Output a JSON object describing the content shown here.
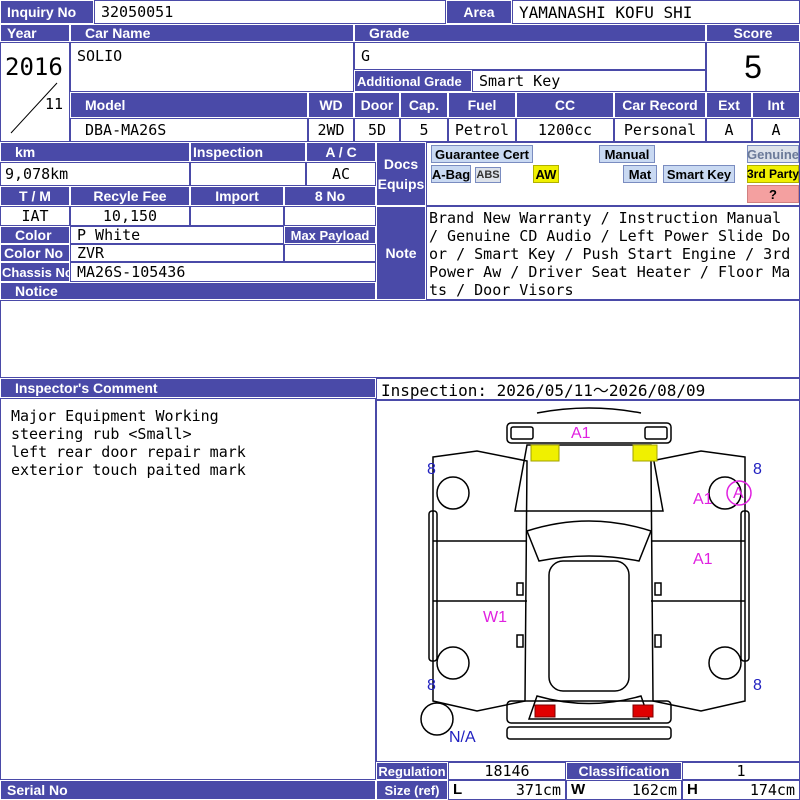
{
  "inquiry": {
    "label": "Inquiry No",
    "value": "32050051"
  },
  "area": {
    "label": "Area",
    "value": "YAMANASHI KOFU SHI"
  },
  "year": {
    "label": "Year",
    "value": "2016",
    "month": "11"
  },
  "car_name": {
    "label": "Car Name",
    "value": "SOLIO"
  },
  "grade": {
    "label": "Grade",
    "value": "G",
    "additional_label": "Additional Grade",
    "additional_value": "Smart Key"
  },
  "score": {
    "label": "Score",
    "value": "5"
  },
  "specs": {
    "model_label": "Model",
    "model": "DBA-MA26S",
    "wd_label": "WD",
    "wd": "2WD",
    "door_label": "Door",
    "door": "5D",
    "cap_label": "Cap.",
    "cap": "5",
    "fuel_label": "Fuel",
    "fuel": "Petrol",
    "cc_label": "CC",
    "cc": "1200cc",
    "record_label": "Car Record",
    "record": "Personal",
    "ext_label": "Ext",
    "ext": "A",
    "int_label": "Int",
    "int": "A"
  },
  "km": {
    "label": "km",
    "value": "9,078km"
  },
  "inspection_label": "Inspection",
  "ac": {
    "label": "A / C",
    "value": "AC"
  },
  "docs_label": "Docs Equips",
  "equip": {
    "guarantee": "Guarantee Cert",
    "manual": "Manual",
    "genuine": "Genuine",
    "abag": "A-Bag",
    "abs": "ABS",
    "aw": "AW",
    "mat": "Mat",
    "smart_key": "Smart Key",
    "third_party": "3rd Party",
    "question": "?"
  },
  "tm": {
    "label": "T / M",
    "value": "IAT"
  },
  "recycle": {
    "label": "Recyle Fee",
    "value": "10,150"
  },
  "import_label": "Import",
  "no8_label": "8 No",
  "color": {
    "label": "Color",
    "value": "P White"
  },
  "max_payload_label": "Max Payload",
  "color_no": {
    "label": "Color No",
    "value": "ZVR"
  },
  "chassis": {
    "label": "Chassis No",
    "value": "MA26S-105436"
  },
  "notice_label": "Notice",
  "note": {
    "label": "Note",
    "value": "Brand New Warranty / Instruction Manual / Genuine CD Audio / Left Power Slide Door / Smart Key / Push Start Engine / 3rd Power Aw / Driver Seat Heater / Floor Mats / Door Visors"
  },
  "inspector": {
    "label": "Inspector's Comment",
    "lines": [
      "Major Equipment Working",
      "steering rub <Small>",
      "left rear door repair mark",
      "exterior touch paited mark"
    ]
  },
  "inspection_period": "Inspection: 2026/05/11〜2026/08/09",
  "marks": {
    "a1_top": "A1",
    "a1_right_front": "A1",
    "a_circle": "A",
    "a1_right_rear": "A1",
    "w1": "W1",
    "n_tl": "8",
    "n_tr": "8",
    "n_bl": "8",
    "n_br": "8",
    "na": "N/A"
  },
  "regulation": {
    "label": "Regulation",
    "value": "18146"
  },
  "classification": {
    "label": "Classification",
    "value": "1"
  },
  "size": {
    "label": "Size (ref)",
    "l_label": "L",
    "l": "371cm",
    "w_label": "W",
    "w": "162cm",
    "h_label": "H",
    "h": "174cm"
  },
  "serial_label": "Serial No",
  "colors": {
    "header": "#4a4aa8",
    "damage_mark": "#e020e0",
    "number_mark": "#2020c0",
    "aw_yellow": "#f0f000",
    "tail_red": "#e00000"
  }
}
